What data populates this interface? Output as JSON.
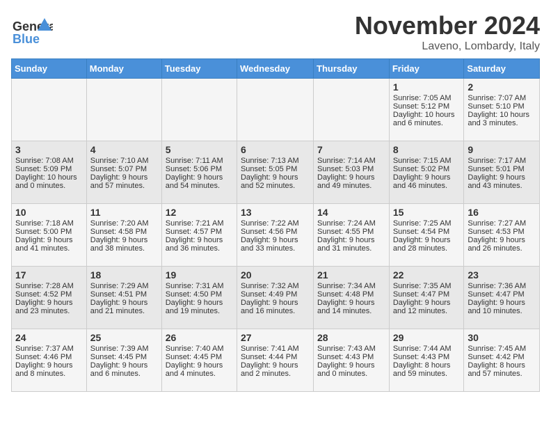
{
  "header": {
    "logo_general": "General",
    "logo_blue": "Blue",
    "month_title": "November 2024",
    "location": "Laveno, Lombardy, Italy"
  },
  "weekdays": [
    "Sunday",
    "Monday",
    "Tuesday",
    "Wednesday",
    "Thursday",
    "Friday",
    "Saturday"
  ],
  "weeks": [
    [
      {
        "day": "",
        "info": ""
      },
      {
        "day": "",
        "info": ""
      },
      {
        "day": "",
        "info": ""
      },
      {
        "day": "",
        "info": ""
      },
      {
        "day": "",
        "info": ""
      },
      {
        "day": "1",
        "info": "Sunrise: 7:05 AM\nSunset: 5:12 PM\nDaylight: 10 hours and 6 minutes."
      },
      {
        "day": "2",
        "info": "Sunrise: 7:07 AM\nSunset: 5:10 PM\nDaylight: 10 hours and 3 minutes."
      }
    ],
    [
      {
        "day": "3",
        "info": "Sunrise: 7:08 AM\nSunset: 5:09 PM\nDaylight: 10 hours and 0 minutes."
      },
      {
        "day": "4",
        "info": "Sunrise: 7:10 AM\nSunset: 5:07 PM\nDaylight: 9 hours and 57 minutes."
      },
      {
        "day": "5",
        "info": "Sunrise: 7:11 AM\nSunset: 5:06 PM\nDaylight: 9 hours and 54 minutes."
      },
      {
        "day": "6",
        "info": "Sunrise: 7:13 AM\nSunset: 5:05 PM\nDaylight: 9 hours and 52 minutes."
      },
      {
        "day": "7",
        "info": "Sunrise: 7:14 AM\nSunset: 5:03 PM\nDaylight: 9 hours and 49 minutes."
      },
      {
        "day": "8",
        "info": "Sunrise: 7:15 AM\nSunset: 5:02 PM\nDaylight: 9 hours and 46 minutes."
      },
      {
        "day": "9",
        "info": "Sunrise: 7:17 AM\nSunset: 5:01 PM\nDaylight: 9 hours and 43 minutes."
      }
    ],
    [
      {
        "day": "10",
        "info": "Sunrise: 7:18 AM\nSunset: 5:00 PM\nDaylight: 9 hours and 41 minutes."
      },
      {
        "day": "11",
        "info": "Sunrise: 7:20 AM\nSunset: 4:58 PM\nDaylight: 9 hours and 38 minutes."
      },
      {
        "day": "12",
        "info": "Sunrise: 7:21 AM\nSunset: 4:57 PM\nDaylight: 9 hours and 36 minutes."
      },
      {
        "day": "13",
        "info": "Sunrise: 7:22 AM\nSunset: 4:56 PM\nDaylight: 9 hours and 33 minutes."
      },
      {
        "day": "14",
        "info": "Sunrise: 7:24 AM\nSunset: 4:55 PM\nDaylight: 9 hours and 31 minutes."
      },
      {
        "day": "15",
        "info": "Sunrise: 7:25 AM\nSunset: 4:54 PM\nDaylight: 9 hours and 28 minutes."
      },
      {
        "day": "16",
        "info": "Sunrise: 7:27 AM\nSunset: 4:53 PM\nDaylight: 9 hours and 26 minutes."
      }
    ],
    [
      {
        "day": "17",
        "info": "Sunrise: 7:28 AM\nSunset: 4:52 PM\nDaylight: 9 hours and 23 minutes."
      },
      {
        "day": "18",
        "info": "Sunrise: 7:29 AM\nSunset: 4:51 PM\nDaylight: 9 hours and 21 minutes."
      },
      {
        "day": "19",
        "info": "Sunrise: 7:31 AM\nSunset: 4:50 PM\nDaylight: 9 hours and 19 minutes."
      },
      {
        "day": "20",
        "info": "Sunrise: 7:32 AM\nSunset: 4:49 PM\nDaylight: 9 hours and 16 minutes."
      },
      {
        "day": "21",
        "info": "Sunrise: 7:34 AM\nSunset: 4:48 PM\nDaylight: 9 hours and 14 minutes."
      },
      {
        "day": "22",
        "info": "Sunrise: 7:35 AM\nSunset: 4:47 PM\nDaylight: 9 hours and 12 minutes."
      },
      {
        "day": "23",
        "info": "Sunrise: 7:36 AM\nSunset: 4:47 PM\nDaylight: 9 hours and 10 minutes."
      }
    ],
    [
      {
        "day": "24",
        "info": "Sunrise: 7:37 AM\nSunset: 4:46 PM\nDaylight: 9 hours and 8 minutes."
      },
      {
        "day": "25",
        "info": "Sunrise: 7:39 AM\nSunset: 4:45 PM\nDaylight: 9 hours and 6 minutes."
      },
      {
        "day": "26",
        "info": "Sunrise: 7:40 AM\nSunset: 4:45 PM\nDaylight: 9 hours and 4 minutes."
      },
      {
        "day": "27",
        "info": "Sunrise: 7:41 AM\nSunset: 4:44 PM\nDaylight: 9 hours and 2 minutes."
      },
      {
        "day": "28",
        "info": "Sunrise: 7:43 AM\nSunset: 4:43 PM\nDaylight: 9 hours and 0 minutes."
      },
      {
        "day": "29",
        "info": "Sunrise: 7:44 AM\nSunset: 4:43 PM\nDaylight: 8 hours and 59 minutes."
      },
      {
        "day": "30",
        "info": "Sunrise: 7:45 AM\nSunset: 4:42 PM\nDaylight: 8 hours and 57 minutes."
      }
    ]
  ]
}
